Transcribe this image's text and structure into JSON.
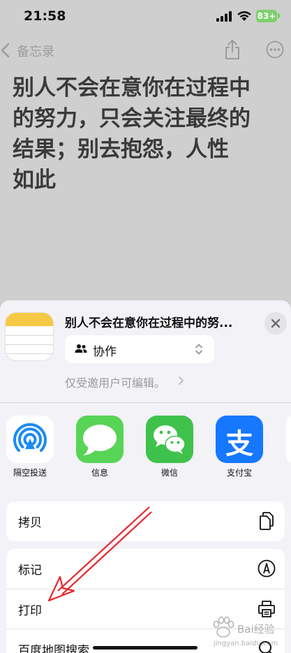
{
  "status_bar": {
    "time": "21:58",
    "battery": "83+"
  },
  "nav": {
    "back_label": "备忘录"
  },
  "note": {
    "title_lines": [
      "别人不会在意你在过程中",
      "的努力，只会关注最终的",
      "结果；别去抱怨，人性",
      "如此"
    ]
  },
  "share_sheet": {
    "title": "别人不会在意你在过程中的努...",
    "collab_label": "协作",
    "permission_text": "仅受邀用户可编辑。",
    "apps": [
      {
        "label": "隔空投送",
        "icon": "airdrop-icon"
      },
      {
        "label": "信息",
        "icon": "messages-icon"
      },
      {
        "label": "微信",
        "icon": "wechat-icon"
      },
      {
        "label": "支付宝",
        "icon": "alipay-icon",
        "glyph": "支"
      }
    ],
    "actions": [
      {
        "label": "拷贝",
        "icon": "copy-icon"
      },
      {
        "label": "标记",
        "icon": "markup-icon"
      },
      {
        "label": "打印",
        "icon": "print-icon"
      },
      {
        "label": "百度地图搜索",
        "icon": "search-icon"
      }
    ]
  },
  "colors": {
    "accent_airdrop": "#1a8bf3",
    "messages_green": "#58d456",
    "wechat_green": "#3fc24c",
    "alipay_blue": "#1677ff",
    "annotation_red": "#e8232b"
  },
  "watermark": {
    "text": "Bai经验",
    "subtext": "jingyan.baidu.com"
  }
}
